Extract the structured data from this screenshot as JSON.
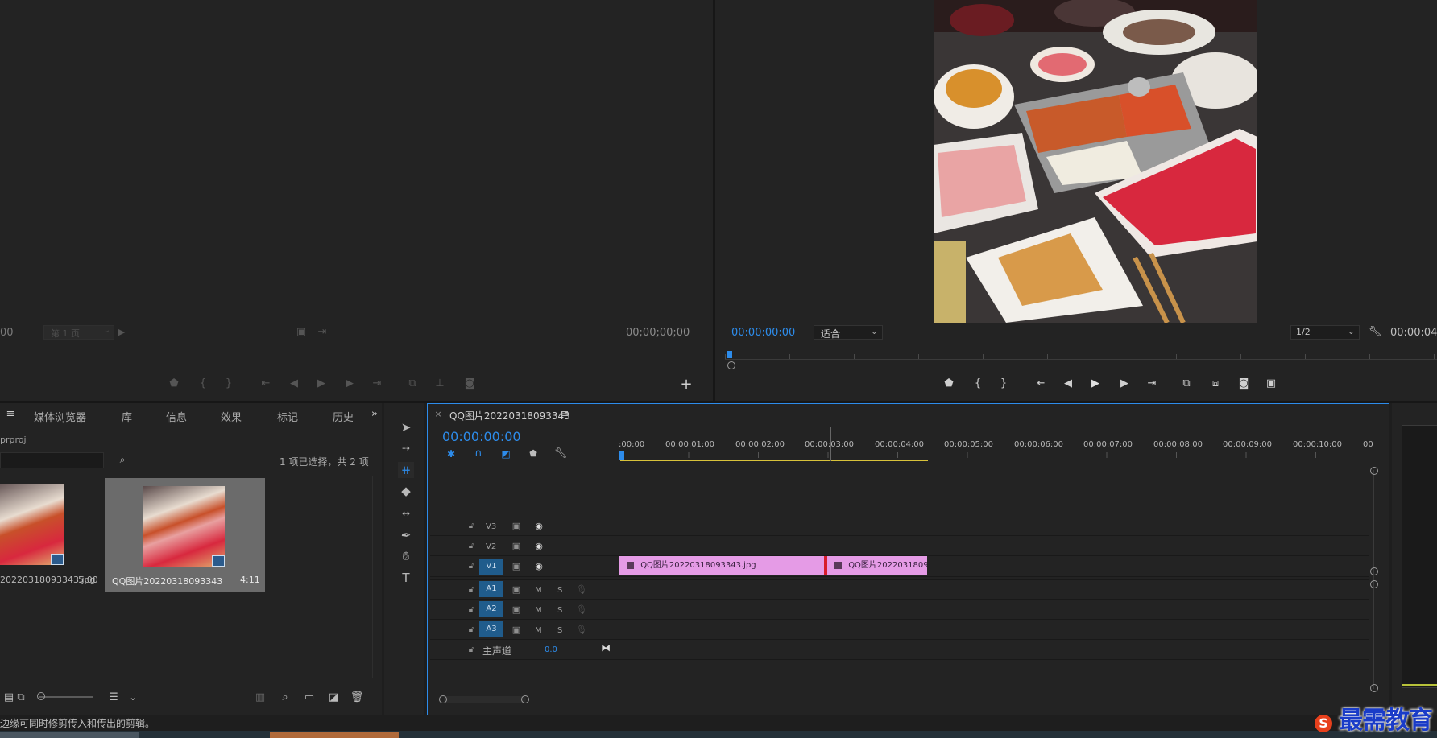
{
  "source_monitor": {
    "left_timecode": "00",
    "page_select": "第 1 页",
    "timecode": "00;00;00;00"
  },
  "program_monitor": {
    "timecode": "00:00:00:00",
    "fit_select": "适合",
    "resolution_select": "1/2",
    "duration_timecode": "00:00:04"
  },
  "project_panel": {
    "tabs": [
      "媒体浏览器",
      "库",
      "信息",
      "效果",
      "标记",
      "历史"
    ],
    "project_name": "prproj",
    "selection_status": "1 项已选择，共 2 项",
    "items": [
      {
        "name": "20220318093343.jpg",
        "duration": "5:00"
      },
      {
        "name": "QQ图片20220318093343",
        "duration": "4:11"
      }
    ]
  },
  "timeline": {
    "sequence_name": "QQ图片20220318093343",
    "timecode": "00:00:00:00",
    "ruler_labels": [
      ":00:00",
      "00:00:01:00",
      "00:00:02:00",
      "00:00:03:00",
      "00:00:04:00",
      "00:00:05:00",
      "00:00:06:00",
      "00:00:07:00",
      "00:00:08:00",
      "00:00:09:00",
      "00:00:10:00",
      "00"
    ],
    "video_tracks": [
      "V3",
      "V2",
      "V1"
    ],
    "audio_tracks": [
      "A1",
      "A2",
      "A3"
    ],
    "track_letters": {
      "mute": "M",
      "solo": "S"
    },
    "master_label": "主声道",
    "master_value": "0.0",
    "clips": [
      {
        "name": "QQ图片20220318093343.jpg"
      },
      {
        "name": "QQ图片20220318093"
      }
    ]
  },
  "status_bar": {
    "text": "边缘可同时修剪传入和传出的剪辑。"
  },
  "watermark": {
    "text": "最需教育"
  }
}
